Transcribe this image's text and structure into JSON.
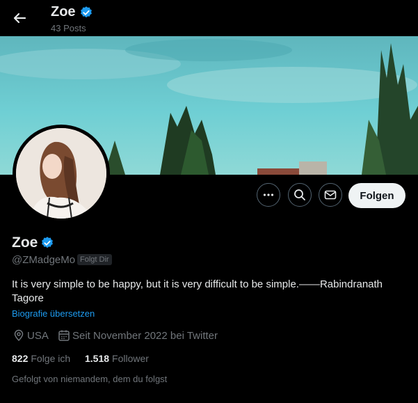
{
  "header": {
    "back_icon": "arrow-left-icon",
    "name": "Zoe",
    "posts_count": "43 Posts"
  },
  "profile": {
    "name": "Zoe",
    "verified_icon": "verified-badge-icon",
    "handle": "@ZMadgeMo",
    "follows_you_badge": "Folgt Dir",
    "bio": "It is very simple to be happy, but it is very difficult to be simple.——Rabindranath Tagore",
    "translate_link": "Biografie übersetzen",
    "location": "USA",
    "joined": "Seit November 2022 bei Twitter",
    "following_count": "822",
    "following_label": "Folge ich",
    "followers_count": "1.518",
    "followers_label": "Follower",
    "followed_by_text": "Gefolgt von niemandem, dem du folgst"
  },
  "actions": {
    "more_icon": "more-dots-icon",
    "search_icon": "search-icon",
    "message_icon": "envelope-icon",
    "follow_label": "Folgen"
  },
  "colors": {
    "background": "#000000",
    "accent": "#1d9bf0",
    "muted_text": "#71767b",
    "primary_text": "#e7e9ea"
  }
}
